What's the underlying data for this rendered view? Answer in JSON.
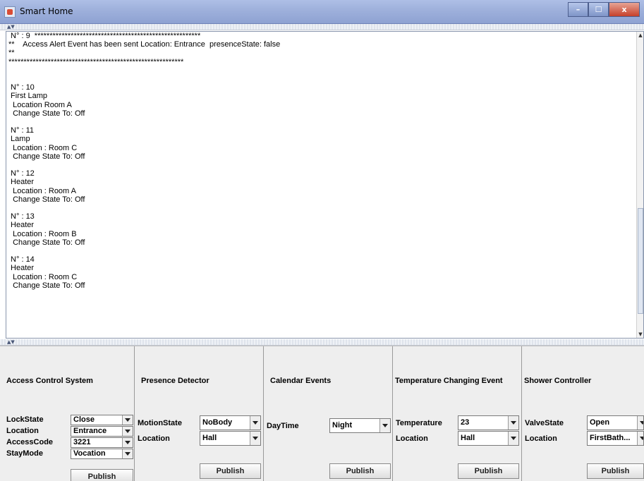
{
  "window": {
    "title": "Smart Home",
    "minimize": "–",
    "maximize": "☐",
    "close": "x"
  },
  "log": {
    "text": " N° : 9  *******************************************************\n**    Access Alert Event has been sent Location: Entrance  presenceState: false\n**\n**********************************************************\n\n\n N° : 10\n First Lamp\n  Location Room A\n  Change State To: Off\n\n N° : 11\n Lamp\n  Location : Room C\n  Change State To: Off\n\n N° : 12\n Heater\n  Location : Room A\n  Change State To: Off\n\n N° : 13\n Heater\n  Location : Room B\n  Change State To: Off\n\n N° : 14\n Heater\n  Location : Room C\n  Change State To: Off"
  },
  "panels": {
    "access": {
      "title": "Access Control System",
      "lock_state_label": "LockState",
      "lock_state_value": "Close",
      "location_label": "Location",
      "location_value": "Entrance",
      "access_code_label": "AccessCode",
      "access_code_value": "3221",
      "stay_mode_label": "StayMode",
      "stay_mode_value": "Vocation",
      "publish": "Publish"
    },
    "presence": {
      "title": "Presence Detector",
      "motion_label": "MotionState",
      "motion_value": "NoBody",
      "location_label": "Location",
      "location_value": "Hall",
      "publish": "Publish"
    },
    "calendar": {
      "title": "Calendar Events",
      "daytime_label": "DayTime",
      "daytime_value": "Night",
      "publish": "Publish"
    },
    "temperature": {
      "title": "Temperature Changing Event",
      "temp_label": "Temperature",
      "temp_value": "23",
      "location_label": "Location",
      "location_value": "Hall",
      "publish": "Publish"
    },
    "shower": {
      "title": "Shower Controller",
      "valve_label": "ValveState",
      "valve_value": "Open",
      "location_label": "Location",
      "location_value": "FirstBath...",
      "publish": "Publish"
    }
  }
}
